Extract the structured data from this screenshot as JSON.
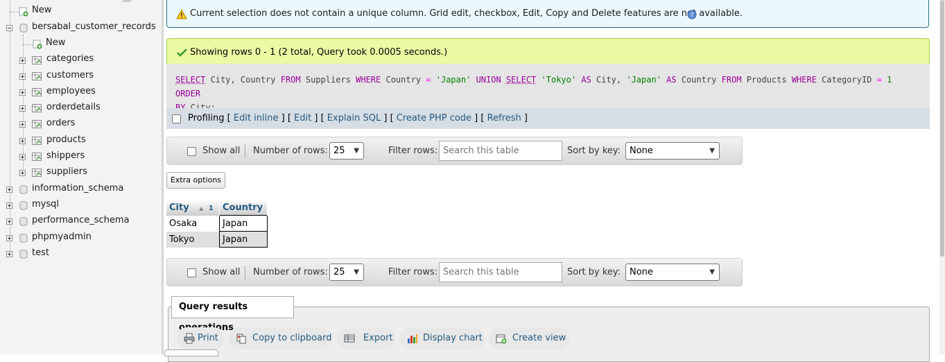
{
  "sidebar": {
    "tree": [
      {
        "label": "New",
        "type": "new",
        "level": 1
      },
      {
        "label": "bersabal_customer_records",
        "type": "db",
        "level": 0,
        "expanded": true
      },
      {
        "label": "New",
        "type": "new",
        "level": 2
      },
      {
        "label": "categories",
        "type": "table",
        "level": 2
      },
      {
        "label": "customers",
        "type": "table",
        "level": 2
      },
      {
        "label": "employees",
        "type": "table",
        "level": 2
      },
      {
        "label": "orderdetails",
        "type": "table",
        "level": 2
      },
      {
        "label": "orders",
        "type": "table",
        "level": 2
      },
      {
        "label": "products",
        "type": "table",
        "level": 2
      },
      {
        "label": "shippers",
        "type": "table",
        "level": 2
      },
      {
        "label": "suppliers",
        "type": "table",
        "level": 2
      },
      {
        "label": "information_schema",
        "type": "db",
        "level": 0
      },
      {
        "label": "mysql",
        "type": "db",
        "level": 0
      },
      {
        "label": "performance_schema",
        "type": "db",
        "level": 0
      },
      {
        "label": "phpmyadmin",
        "type": "db",
        "level": 0
      },
      {
        "label": "test",
        "type": "db",
        "level": 0
      }
    ]
  },
  "notice": {
    "text": "Current selection does not contain a unique column. Grid edit, checkbox, Edit, Copy and Delete features are not available."
  },
  "success": {
    "text": "Showing rows 0 - 1 (2 total, Query took 0.0005 seconds.)"
  },
  "sql": {
    "line1_tokens": [
      {
        "t": "SELECT",
        "c": "kw-u"
      },
      {
        "t": " City, Country ",
        "c": ""
      },
      {
        "t": "FROM",
        "c": "kw"
      },
      {
        "t": " Suppliers ",
        "c": ""
      },
      {
        "t": "WHERE",
        "c": "kw"
      },
      {
        "t": " Country ",
        "c": ""
      },
      {
        "t": "=",
        "c": "op"
      },
      {
        "t": " ",
        "c": ""
      },
      {
        "t": "'Japan'",
        "c": "str"
      },
      {
        "t": " ",
        "c": ""
      },
      {
        "t": "UNION",
        "c": "kw"
      },
      {
        "t": " ",
        "c": ""
      },
      {
        "t": "SELECT",
        "c": "kw-u"
      },
      {
        "t": " ",
        "c": ""
      },
      {
        "t": "'Tokyo'",
        "c": "str"
      },
      {
        "t": " ",
        "c": ""
      },
      {
        "t": "AS",
        "c": "kw"
      },
      {
        "t": " City, ",
        "c": ""
      },
      {
        "t": "'Japan'",
        "c": "str"
      },
      {
        "t": " ",
        "c": ""
      },
      {
        "t": "AS",
        "c": "kw"
      },
      {
        "t": " Country ",
        "c": ""
      },
      {
        "t": "FROM",
        "c": "kw"
      },
      {
        "t": " Products ",
        "c": ""
      },
      {
        "t": "WHERE",
        "c": "kw"
      },
      {
        "t": " CategoryID ",
        "c": ""
      },
      {
        "t": "=",
        "c": "op"
      },
      {
        "t": " ",
        "c": ""
      },
      {
        "t": "1",
        "c": "num"
      },
      {
        "t": " ",
        "c": ""
      },
      {
        "t": "ORDER",
        "c": "kw"
      }
    ],
    "line2_tokens": [
      {
        "t": "BY",
        "c": "kw"
      },
      {
        "t": " City;",
        "c": ""
      }
    ]
  },
  "profiling": {
    "label": "Profiling",
    "links": [
      "Edit inline",
      "Edit",
      "Explain SQL",
      "Create PHP code",
      "Refresh"
    ]
  },
  "navigation": {
    "show_all": "Show all",
    "num_rows_label": "Number of rows:",
    "num_rows_value": "25",
    "filter_label": "Filter rows:",
    "filter_placeholder": "Search this table",
    "sort_label": "Sort by key:",
    "sort_value": "None"
  },
  "extra_options": "Extra options",
  "results": {
    "columns": [
      "City",
      "Country"
    ],
    "sort_indicator": "1",
    "rows": [
      [
        "Osaka",
        "Japan"
      ],
      [
        "Tokyo",
        "Japan"
      ]
    ]
  },
  "operations": {
    "legend": "Query results operations",
    "buttons": [
      {
        "label": "Print",
        "icon": "print-icon"
      },
      {
        "label": "Copy to clipboard",
        "icon": "copy-icon"
      },
      {
        "label": "Export",
        "icon": "export-icon"
      },
      {
        "label": "Display chart",
        "icon": "chart-icon"
      },
      {
        "label": "Create view",
        "icon": "view-icon"
      }
    ]
  },
  "colors": {
    "link": "#235a81",
    "notice_bg": "#ebf8fd",
    "success_bg": "#ebf8a4",
    "sql_keyword": "#990099",
    "sql_string": "#008000"
  }
}
